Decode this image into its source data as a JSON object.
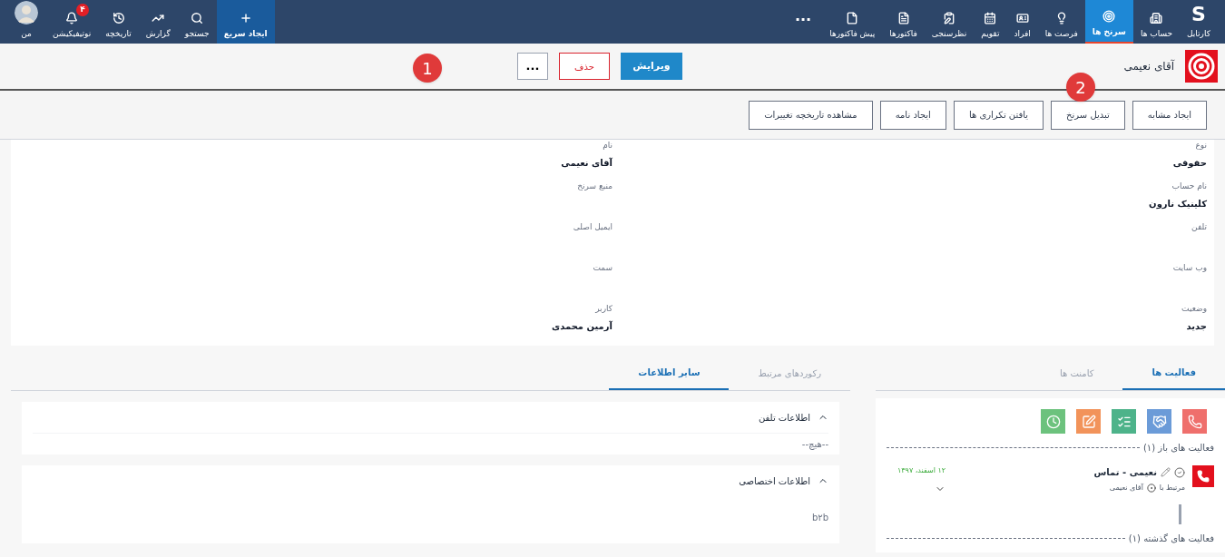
{
  "top_nav": {
    "logo": "S",
    "main_items": [
      {
        "label": "کارتابل",
        "selected": false
      },
      {
        "label": "حساب ها",
        "selected": false
      },
      {
        "label": "سرنخ ها",
        "selected": true
      },
      {
        "label": "فرصت ها",
        "selected": false
      },
      {
        "label": "افراد",
        "selected": false
      },
      {
        "label": "تقویم",
        "selected": false
      },
      {
        "label": "نظرسنجی",
        "selected": false
      },
      {
        "label": "فاکتورها",
        "selected": false
      },
      {
        "label": "پیش فاکتورها",
        "selected": false
      }
    ],
    "more": "...",
    "tool_items": [
      {
        "label": "ایجاد سریع",
        "selected": true
      },
      {
        "label": "جستجو",
        "selected": false
      },
      {
        "label": "گزارش",
        "selected": false
      },
      {
        "label": "تاریخچه",
        "selected": false
      },
      {
        "label": "نوتیفیکیشن",
        "selected": false,
        "badge": "۴"
      },
      {
        "label": "من",
        "selected": false
      }
    ]
  },
  "record_header": {
    "title": "آقای نعیمی",
    "edit_button": "ویرایش",
    "delete_button": "حذف",
    "more_button": "..."
  },
  "annotations": [
    "1",
    "2"
  ],
  "actions": [
    "ایجاد مشابه",
    "تبدیل سرنخ",
    "یافتن تکراری ها",
    "ایجاد نامه",
    "مشاهده تاریخچه تغییرات"
  ],
  "fields": [
    {
      "label": "نوع",
      "value": "حقوقی"
    },
    {
      "label": "نام",
      "value": "آقای نعیمی"
    },
    {
      "label": "نام حساب",
      "value": "کلینیک نارون"
    },
    {
      "label": "منبع سرنخ"
    },
    {
      "label": "تلفن"
    },
    {
      "label": "ایمیل اصلی"
    },
    {
      "label": "وب سایت"
    },
    {
      "label": "سمت"
    },
    {
      "label": "وضعیت",
      "value": "جدید"
    },
    {
      "label": "کاربر",
      "value": "آرمین محمدی"
    }
  ],
  "activity_panel": {
    "tabs": [
      {
        "label": "فعالیت ها",
        "selected": true
      },
      {
        "label": "کامنت ها",
        "selected": false
      }
    ],
    "open_heading": "فعالیت های باز (۱)",
    "activity": {
      "title": "نعیمی - تماس",
      "related_label": "مرتبط با",
      "related_name": "آقای نعیمی",
      "date": "۱۲ اسفند، ۱۳۹۷"
    },
    "past_heading": "فعالیت های گذشته (۱)"
  },
  "info_panel": {
    "tabs": [
      {
        "label": "رکوردهای مرتبط",
        "selected": false
      },
      {
        "label": "سایر اطلاعات",
        "selected": true
      }
    ],
    "sections": [
      {
        "title": "اطلاعات تلفن",
        "expanded": true,
        "value": "--هیچ--"
      },
      {
        "title": "اطلاعات اختصاصی",
        "expanded": true,
        "value": "b۲b"
      }
    ]
  }
}
